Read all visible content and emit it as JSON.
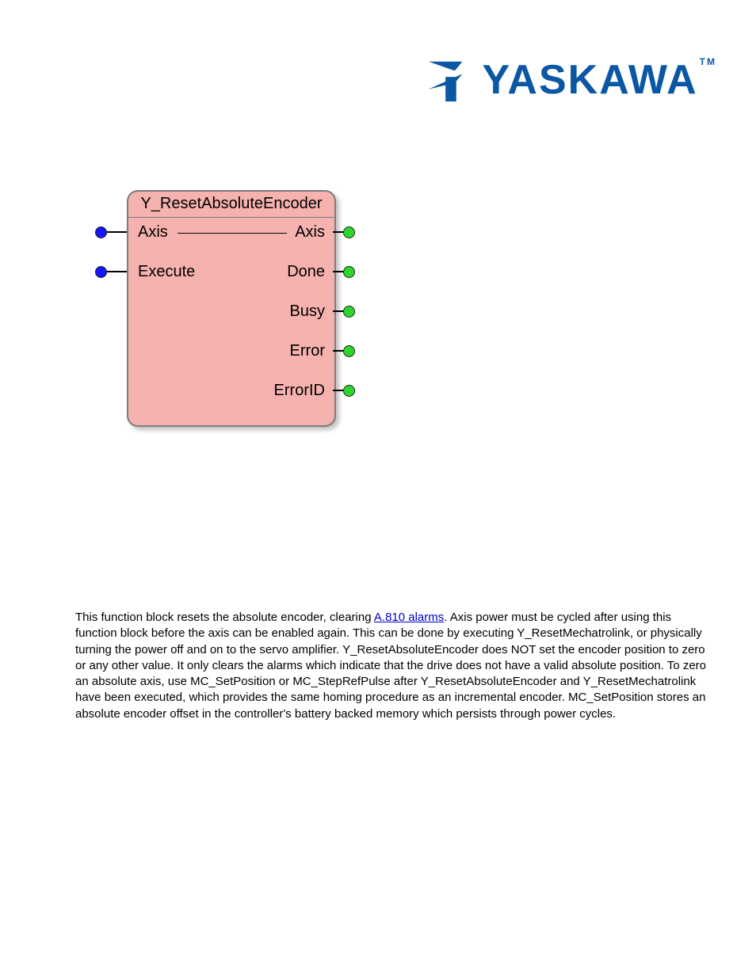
{
  "logo": {
    "brand": "YASKAWA",
    "tm": "TM"
  },
  "fb": {
    "title": "Y_ResetAbsoluteEncoder",
    "inputs": {
      "axis": "Axis",
      "execute": "Execute"
    },
    "outputs": {
      "axis": "Axis",
      "done": "Done",
      "busy": "Busy",
      "error": "Error",
      "errorid": "ErrorID"
    }
  },
  "paragraphs": {
    "p1_a": "This function block resets the absolute encoder, clearing ",
    "p1_link": "A.810 alarms",
    "p1_b": ". Axis power must be cycled after using this function block before the axis can be enabled again. This can be done by executing Y_ResetMechatrolink, or physically turning the power off and on to the servo amplifier. Y_ResetAbsoluteEncoder does NOT set the encoder position to zero or any other value. It only clears the alarms which indicate that the drive does not have a valid absolute position. To zero an absolute axis, use MC_SetPosition or MC_StepRefPulse after Y_ResetAbsoluteEncoder and Y_ResetMechatrolink have been executed, which provides the same homing procedure as an incremental encoder. MC_SetPosition stores an absolute encoder offset in the controller's battery backed memory which persists through power cycles."
  }
}
